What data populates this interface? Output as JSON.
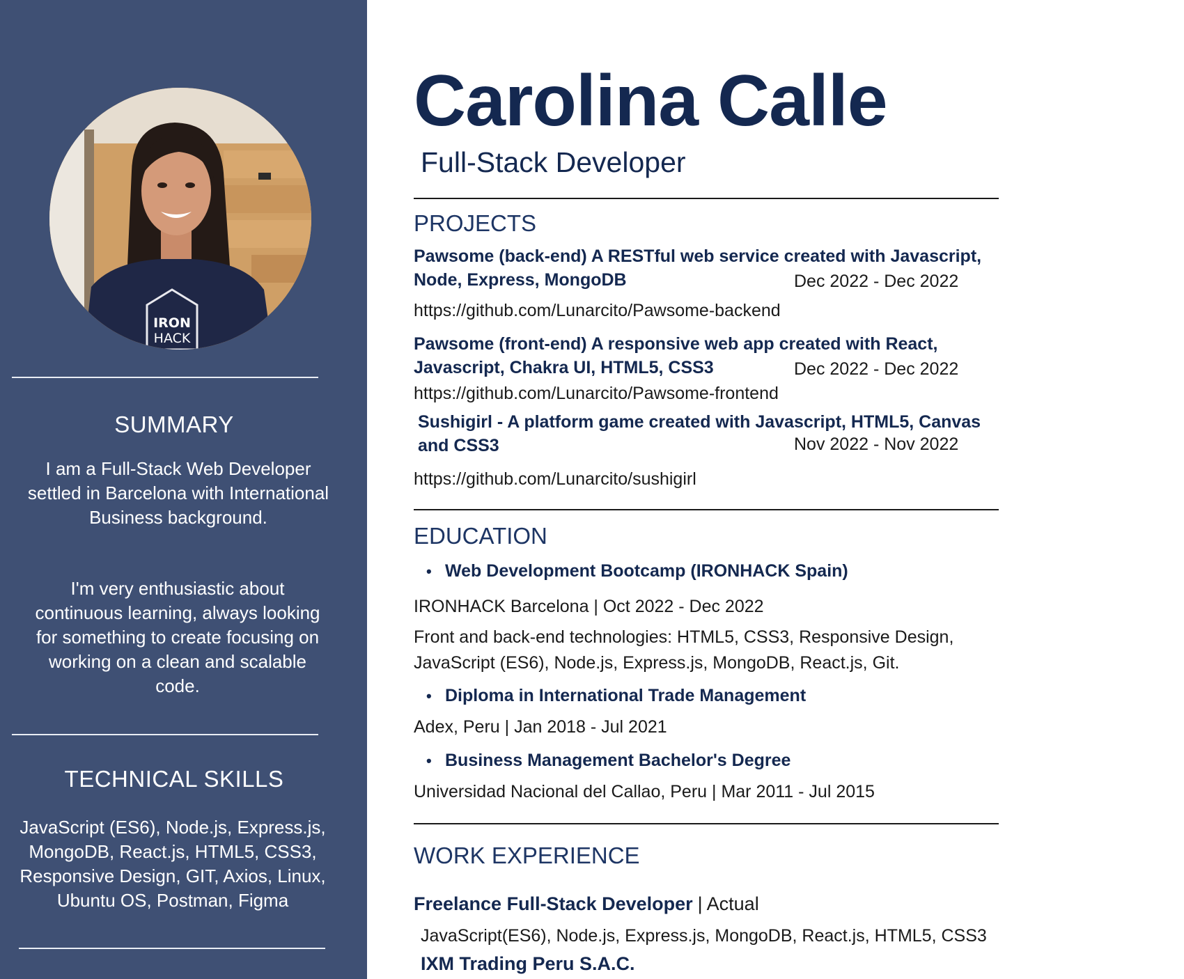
{
  "sidebar": {
    "summary_heading": "SUMMARY",
    "summary_text_1": "I am a Full-Stack Web Developer settled in Barcelona with International Business background.",
    "summary_text_2": "I'm very enthusiastic about continuous learning, always looking for something to create focusing on working on a clean and scalable code.",
    "skills_heading": "TECHNICAL SKILLS",
    "skills_text": "JavaScript (ES6), Node.js, Express.js, MongoDB, React.js, HTML5, CSS3, Responsive Design, GIT, Axios, Linux, Ubuntu OS, Postman, Figma",
    "photo_shirt_logo_line1": "IRON",
    "photo_shirt_logo_line2": "HACK"
  },
  "header": {
    "name": "Carolina Calle",
    "role": "Full-Stack Developer"
  },
  "projects": {
    "heading": "PROJECTS",
    "items": [
      {
        "title": "Pawsome (back-end) A RESTful web service created with Javascript, Node, Express, MongoDB",
        "dates": "Dec 2022 - Dec 2022",
        "link": "https://github.com/Lunarcito/Pawsome-backend"
      },
      {
        "title": "Pawsome (front-end) A responsive web app created with React, Javascript, Chakra UI, HTML5, CSS3",
        "dates": "Dec 2022 - Dec 2022",
        "link": "https://github.com/Lunarcito/Pawsome-frontend"
      },
      {
        "title": "Sushigirl - A platform game created with Javascript, HTML5, Canvas and CSS3",
        "dates": "Nov 2022 - Nov 2022",
        "link": "https://github.com/Lunarcito/sushigirl"
      }
    ]
  },
  "education": {
    "heading": "EDUCATION",
    "items": [
      {
        "title": "Web Development Bootcamp (IRONHACK Spain)",
        "meta": "IRONHACK Barcelona | Oct 2022 - Dec 2022",
        "detail": "Front and back-end technologies: HTML5, CSS3, Responsive Design, JavaScript (ES6), Node.js, Express.js, MongoDB, React.js, Git."
      },
      {
        "title": "Diploma in International Trade Management",
        "meta": "Adex, Peru | Jan 2018 - Jul 2021"
      },
      {
        "title": "Business Management Bachelor's Degree",
        "meta": "Universidad Nacional del Callao, Peru | Mar 2011 - Jul 2015"
      }
    ]
  },
  "work": {
    "heading": "WORK EXPERIENCE",
    "items": [
      {
        "title": "Freelance Full-Stack Developer",
        "period": "| Actual",
        "stack": "JavaScript(ES6), Node.js, Express.js, MongoDB, React.js, HTML5, CSS3"
      },
      {
        "title": "IXM Trading Peru S.A.C."
      }
    ]
  },
  "colors": {
    "sidebar": "#3f5074",
    "navy_text": "#142850",
    "section_title": "#1d3564"
  }
}
